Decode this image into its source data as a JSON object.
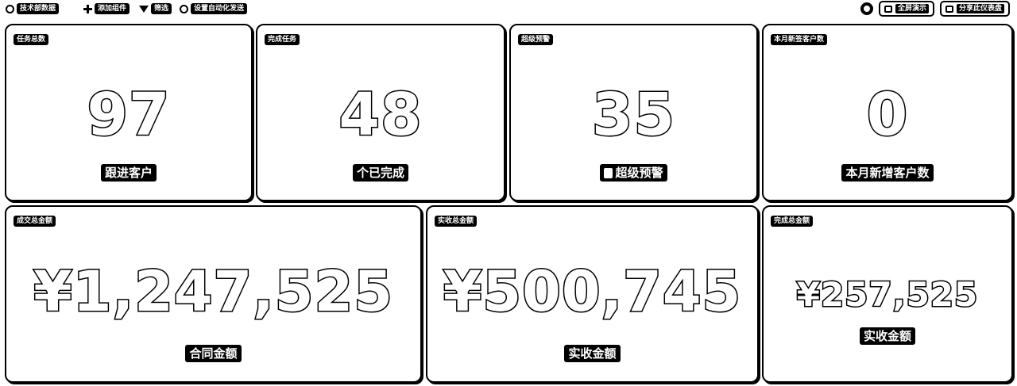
{
  "toolbar": {
    "items": [
      {
        "label": "技术部数据",
        "icon": "circle-icon"
      },
      {
        "label": "添加组件",
        "icon": "plus-icon"
      },
      {
        "label": "筛选",
        "icon": "funnel-icon"
      },
      {
        "label": "设置自动化发送",
        "icon": "clock-icon"
      }
    ],
    "fullscreen_label": "全屏演示",
    "share_label": "分享此仪表盘"
  },
  "cards": {
    "total_tasks": {
      "tag": "任务总数",
      "value": "97",
      "caption": "跟进客户"
    },
    "done_tasks": {
      "tag": "完成任务",
      "value": "48",
      "caption": "个已完成"
    },
    "overdue": {
      "tag": "超级预警",
      "value": "35",
      "caption": "超级预警"
    },
    "new_customers": {
      "tag": "本月新签客户数",
      "value": "0",
      "caption": "本月新增客户数"
    },
    "deal_total": {
      "tag": "成交总金额",
      "value": "¥1,247,525",
      "caption": "合同金额"
    },
    "received_total": {
      "tag": "实收总金额",
      "value": "¥500,745",
      "caption": "实收金额"
    },
    "done_amount": {
      "tag": "完成总金额",
      "value": "¥257,525",
      "caption": "实收金额"
    }
  }
}
